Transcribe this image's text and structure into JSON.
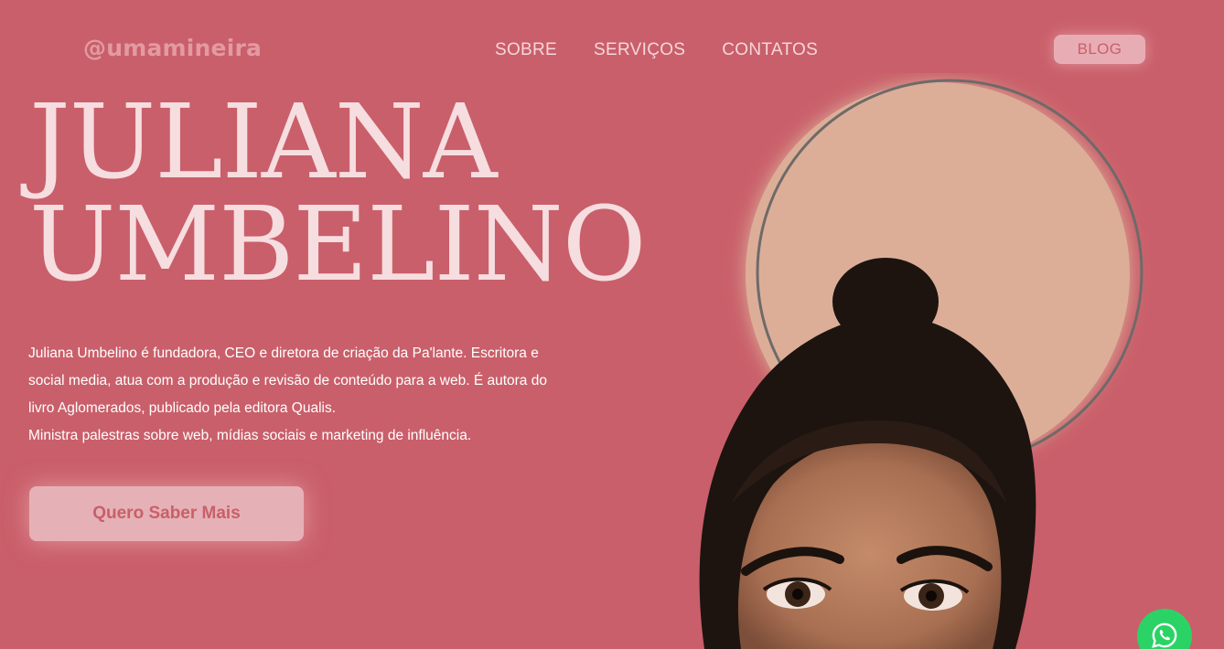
{
  "brand": {
    "handle": "@umamineira"
  },
  "nav": {
    "items": [
      {
        "label": "SOBRE"
      },
      {
        "label": "SERVIÇOS"
      },
      {
        "label": "CONTATOS"
      }
    ],
    "blog_label": "BLOG"
  },
  "hero": {
    "title_line1": "JULIANA",
    "title_line2": "UMBELINO",
    "bio_line1": "Juliana Umbelino é fundadora, CEO e diretora de criação da Pa'lante. Escritora e social media, atua com a produção e revisão de conteúdo para a web. É autora do livro Aglomerados, publicado pela editora Qualis.",
    "bio_line2": "Ministra palestras sobre web, mídias sociais e marketing de influência.",
    "cta_label": "Quero Saber Mais"
  },
  "icons": {
    "whatsapp": "whatsapp-icon"
  },
  "colors": {
    "background": "#c95f6a",
    "accent_light": "#f6dde0",
    "circle": "#dcae98",
    "whatsapp": "#2bd366"
  }
}
